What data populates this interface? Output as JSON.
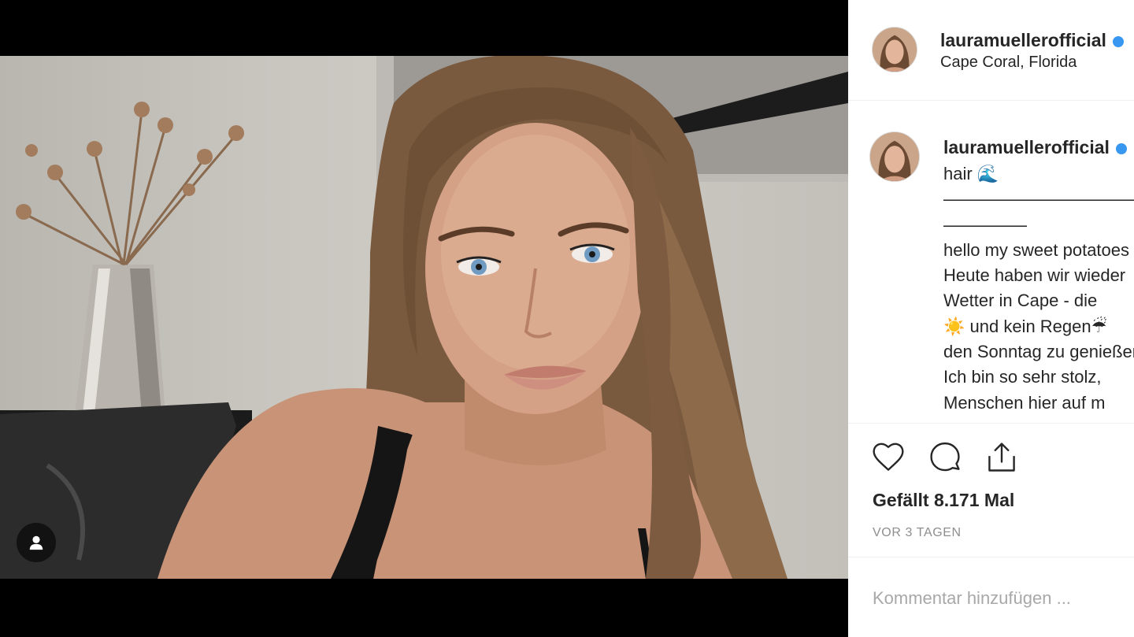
{
  "post": {
    "username": "lauramuellerofficial",
    "location": "Cape Coral, Florida",
    "verified": true
  },
  "caption": {
    "username": "lauramuellerofficial",
    "lines": [
      "hair 🌊",
      "——————————————",
      "—————",
      "hello my sweet potatoes",
      "Heute haben wir wieder",
      "Wetter in Cape - die",
      "☀️ und kein Regen☔",
      "den Sonntag zu genießen",
      "Ich bin so sehr stolz,",
      "Menschen hier auf m"
    ]
  },
  "actions": {
    "icons": [
      "heart-icon",
      "comment-icon",
      "share-icon"
    ],
    "likes": "Gefällt 8.171 Mal",
    "time": "VOR 3 TAGEN"
  },
  "comment_box": {
    "placeholder": "Kommentar hinzufügen ..."
  },
  "colors": {
    "text": "#262626",
    "muted": "#8e8e8e",
    "border": "#efefef",
    "verified": "#3897f0"
  }
}
